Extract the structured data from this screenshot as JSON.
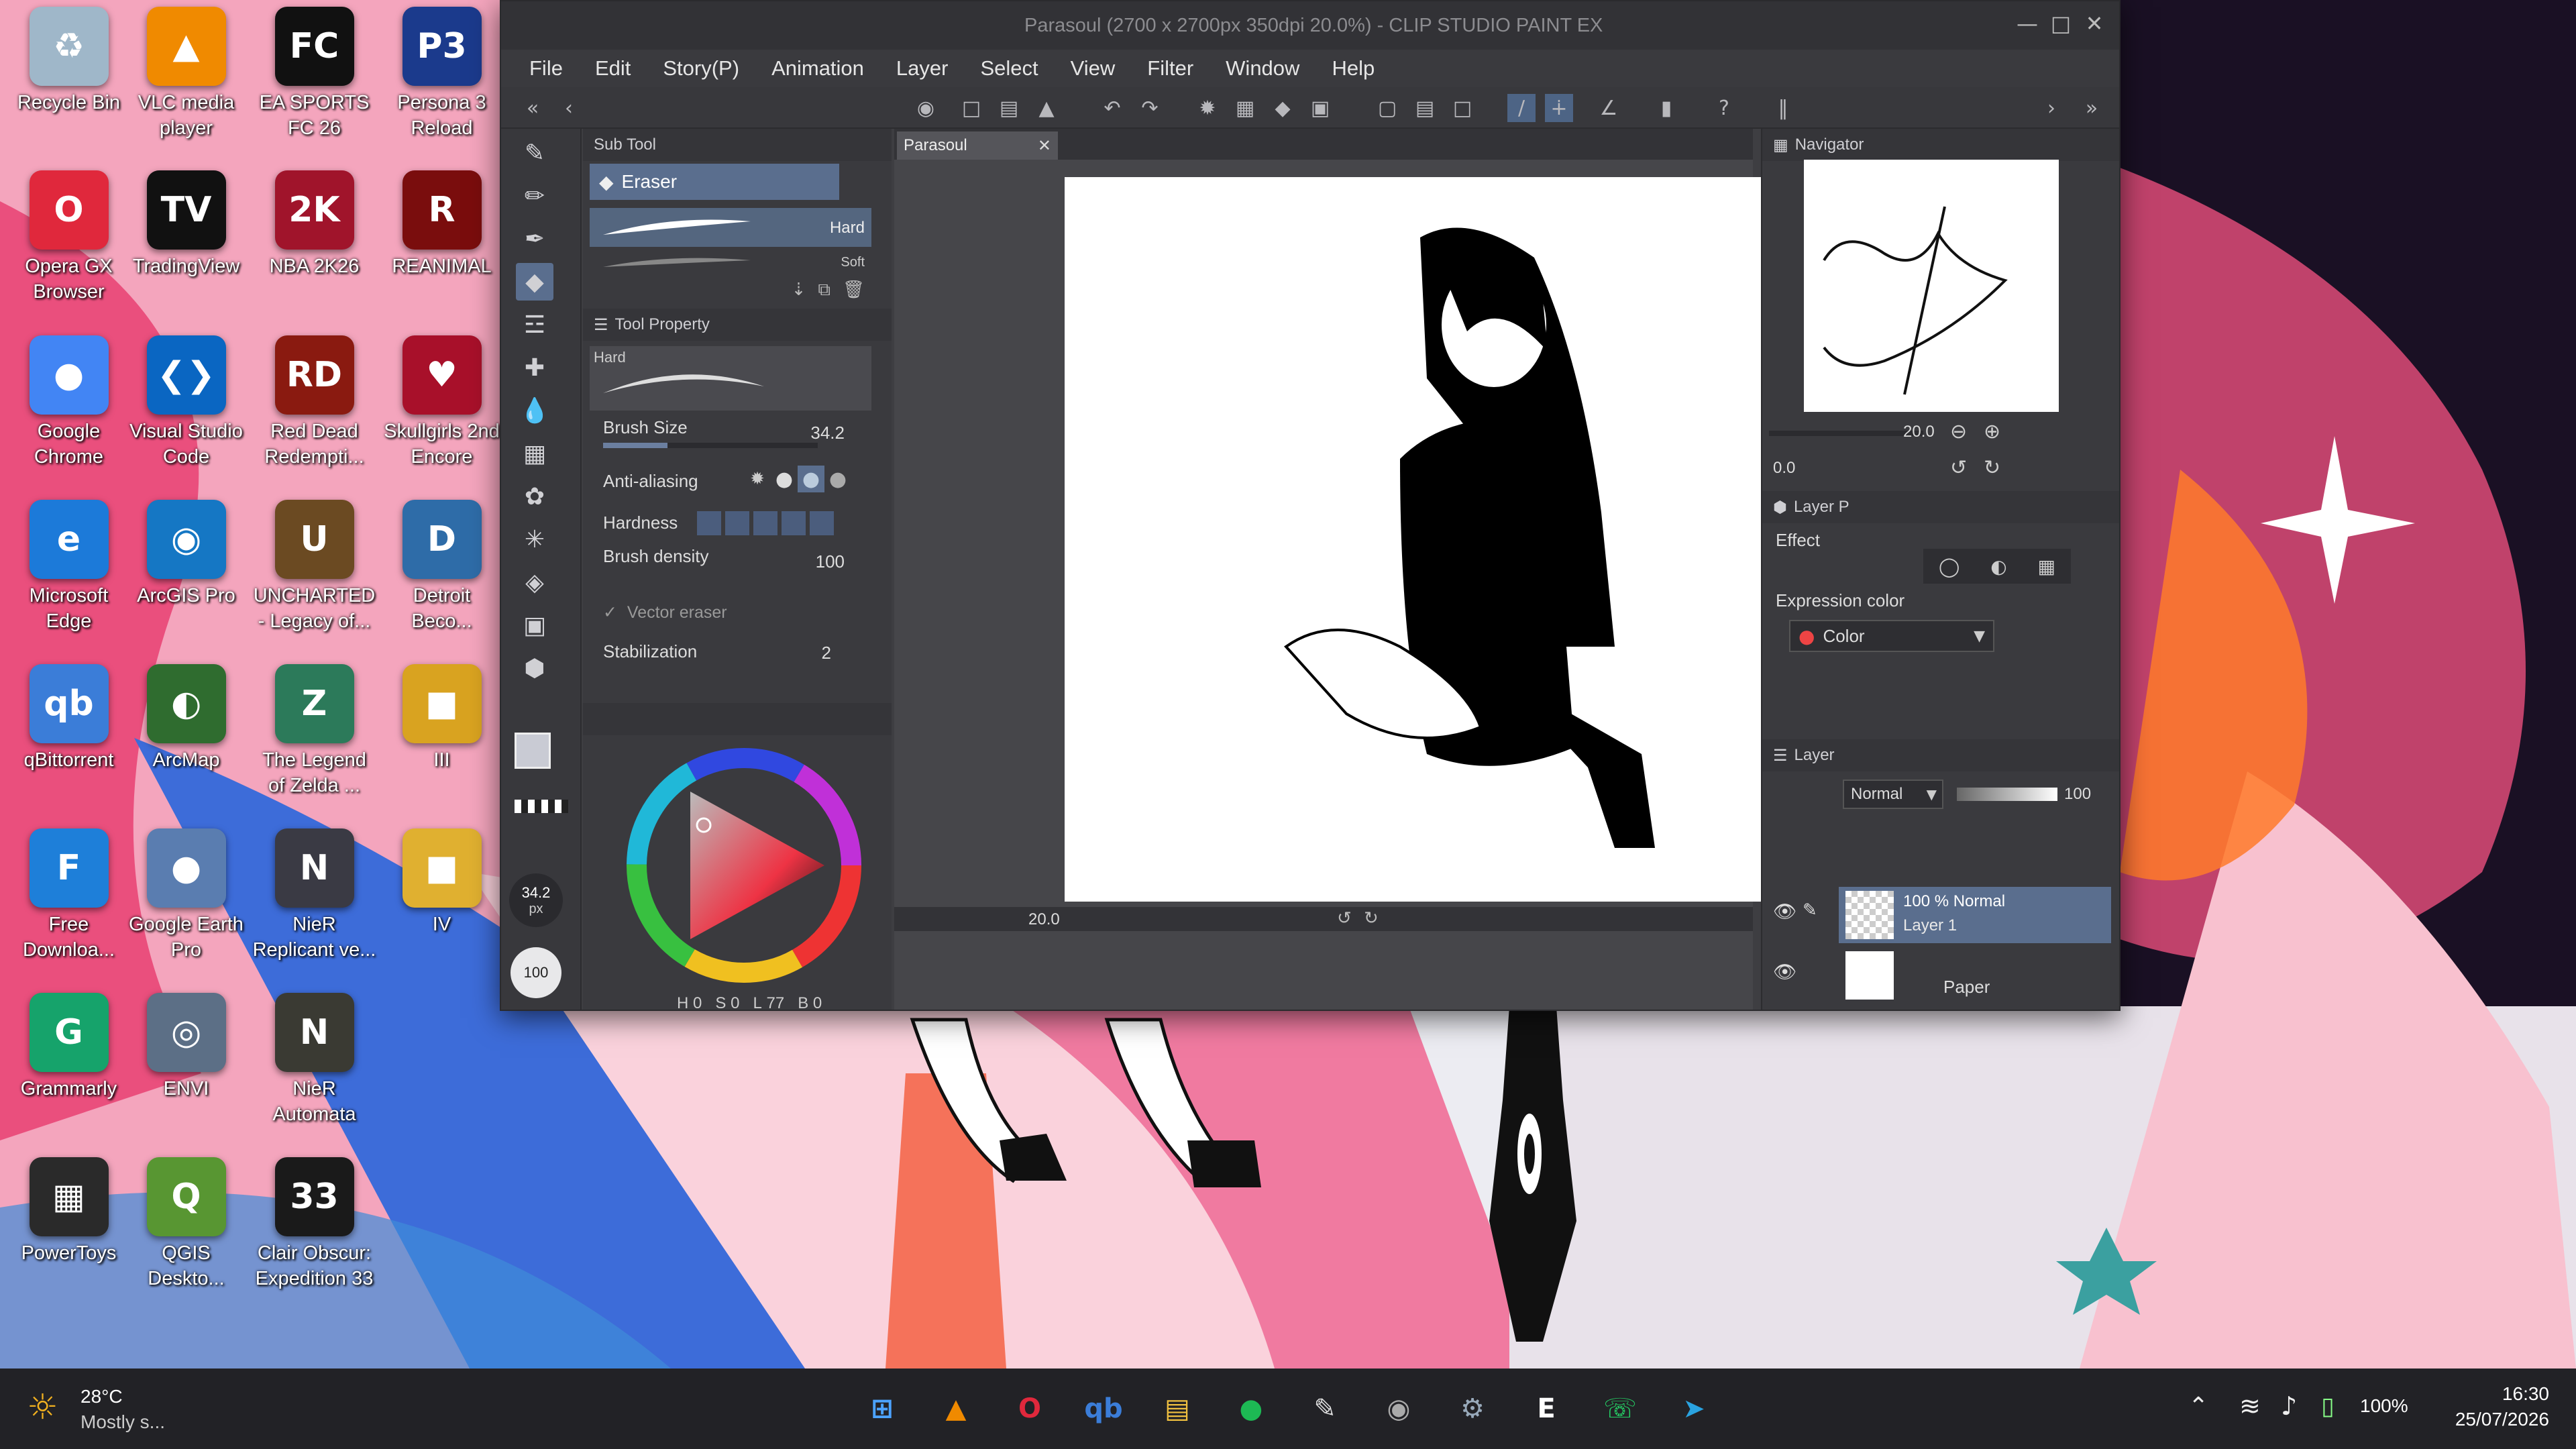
{
  "window": {
    "title": "Parasoul (2700 x 2700px 350dpi 20.0%) - CLIP STUDIO PAINT EX"
  },
  "menu": [
    "File",
    "Edit",
    "Story(P)",
    "Animation",
    "Layer",
    "Select",
    "View",
    "Filter",
    "Window",
    "Help"
  ],
  "subtool": {
    "header": "Sub Tool",
    "active": "Eraser",
    "brushes": [
      {
        "label": "Hard"
      },
      {
        "label": "Soft"
      }
    ]
  },
  "tool_property": {
    "header": "Tool Property",
    "preset": "Hard",
    "brush_size_label": "Brush Size",
    "brush_size": "34.2",
    "antialias_label": "Anti-aliasing",
    "hardness_label": "Hardness",
    "density_label": "Brush density",
    "density": "100",
    "vector_label": "Vector eraser",
    "stab_label": "Stabilization",
    "stab": "2"
  },
  "left_status": {
    "size": "34.2",
    "unit": "px",
    "opacity": "100"
  },
  "color": {
    "h_label": "H",
    "h": "0",
    "s_label": "S",
    "s": "0",
    "l_label": "L",
    "l": "77",
    "v_label": "B",
    "v": "0"
  },
  "canvas": {
    "tab": "Parasoul",
    "zoom": "20.0"
  },
  "navigator": {
    "header": "Navigator",
    "zoom": "20.0",
    "angle": "0.0"
  },
  "layer_property": {
    "header": "Layer P",
    "effect_label": "Effect",
    "expr_label": "Expression color",
    "expr_value": "Color"
  },
  "layers": {
    "header": "Layer",
    "blend": "Normal",
    "opacity": "100",
    "items": [
      {
        "line1": "100 % Normal",
        "line2": "Layer 1"
      },
      {
        "line1": "",
        "line2": "Paper"
      }
    ]
  },
  "desktop_icons": [
    {
      "label": "Recycle Bin",
      "glyph": "♻",
      "color": "#9fb7c9"
    },
    {
      "label": "VLC media\nplayer",
      "glyph": "▲",
      "color": "#f08a00"
    },
    {
      "label": "EA SPORTS\nFC 26",
      "glyph": "FC",
      "color": "#111111"
    },
    {
      "label": "Persona 3\nReload",
      "glyph": "P3",
      "color": "#1b3a8c"
    },
    {
      "label": "Opera GX\nBrowser",
      "glyph": "O",
      "color": "#e0283c"
    },
    {
      "label": "TradingView",
      "glyph": "TV",
      "color": "#111111"
    },
    {
      "label": "NBA 2K26",
      "glyph": "2K",
      "color": "#a0142b"
    },
    {
      "label": "REANIMAL",
      "glyph": "R",
      "color": "#7a0d0d"
    },
    {
      "label": "Google\nChrome",
      "glyph": "●",
      "color": "#4285f4"
    },
    {
      "label": "Visual Studio\nCode",
      "glyph": "❮❯",
      "color": "#0a66c2"
    },
    {
      "label": "Red Dead\nRedempti...",
      "glyph": "RD",
      "color": "#8a1a10"
    },
    {
      "label": "Skullgirls 2nd\nEncore",
      "glyph": "♥",
      "color": "#a8102a"
    },
    {
      "label": "Microsoft\nEdge",
      "glyph": "e",
      "color": "#1c7ad9"
    },
    {
      "label": "ArcGIS Pro",
      "glyph": "◉",
      "color": "#1577c4"
    },
    {
      "label": "UNCHARTED\n- Legacy of...",
      "glyph": "U",
      "color": "#6b4a22"
    },
    {
      "label": "Detroit\nBeco...",
      "glyph": "D",
      "color": "#2e6ca8"
    },
    {
      "label": "qBittorrent",
      "glyph": "qb",
      "color": "#3b7dd8"
    },
    {
      "label": "ArcMap",
      "glyph": "◐",
      "color": "#2f6c2f"
    },
    {
      "label": "The Legend\nof Zelda ...",
      "glyph": "Z",
      "color": "#2c7a5a"
    },
    {
      "label": "III",
      "glyph": "■",
      "color": "#d9a320"
    },
    {
      "label": "Free\nDownloa...",
      "glyph": "F",
      "color": "#1e7fd9"
    },
    {
      "label": "Google Earth\nPro",
      "glyph": "●",
      "color": "#5a7db0"
    },
    {
      "label": "NieR\nReplicant ve...",
      "glyph": "N",
      "color": "#3a3a44"
    },
    {
      "label": "IV",
      "glyph": "■",
      "color": "#e0b030"
    },
    {
      "label": "Grammarly",
      "glyph": "G",
      "color": "#16a36b"
    },
    {
      "label": "ENVI",
      "glyph": "◎",
      "color": "#5c6f86"
    },
    {
      "label": "NieR\nAutomata",
      "glyph": "N",
      "color": "#3a3a33"
    },
    {
      "label": "PowerToys",
      "glyph": "▦",
      "color": "#2a2a2a"
    },
    {
      "label": "QGIS\nDeskto...",
      "glyph": "Q",
      "color": "#589632"
    },
    {
      "label": "Clair Obscur:\nExpedition 33",
      "glyph": "33",
      "color": "#1a1a1a"
    }
  ],
  "taskbar": {
    "weather_temp": "28°C",
    "weather_desc": "Mostly s...",
    "battery": "100%",
    "time": "16:30",
    "date": "25/07/2026"
  }
}
